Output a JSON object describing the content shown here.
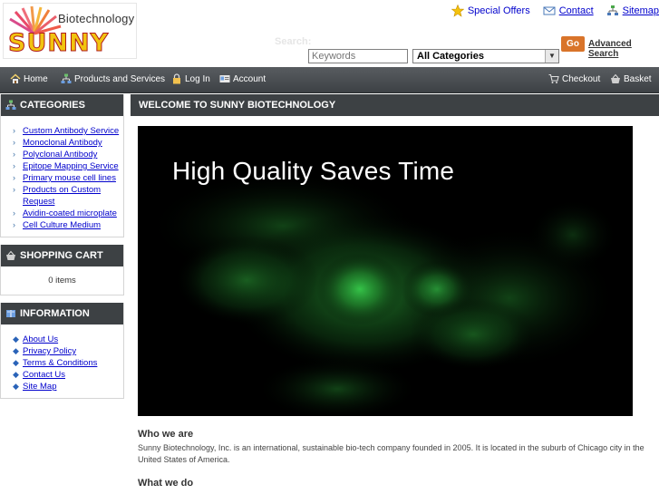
{
  "header": {
    "logo": {
      "line1": "Biotechnology",
      "line2": "SUNNY"
    },
    "toplinks": [
      {
        "label": "Special Offers",
        "icon": "star-icon"
      },
      {
        "label": "Contact",
        "icon": "envelope-icon"
      },
      {
        "label": "Sitemap",
        "icon": "sitemap-icon"
      }
    ],
    "search": {
      "label": "Search:",
      "placeholder": "Keywords",
      "category_selected": "All Categories",
      "go_label": "Go",
      "advanced_label": "Advanced Search"
    }
  },
  "nav": {
    "items": [
      {
        "label": "Home",
        "icon": "home-icon"
      },
      {
        "label": "Products and Services",
        "icon": "sitemap-icon"
      },
      {
        "label": "Log In",
        "icon": "lock-icon"
      },
      {
        "label": "Account",
        "icon": "id-card-icon"
      }
    ],
    "right": [
      {
        "label": "Checkout",
        "icon": "cart-icon"
      },
      {
        "label": "Basket",
        "icon": "basket-icon"
      }
    ]
  },
  "sidebar": {
    "categories": {
      "title": "CATEGORIES",
      "items": [
        "Custom Antibody Service",
        "Monoclonal Antibody",
        "Polyclonal Antibody",
        "Epitope Mapping Service",
        "Primary mouse cell lines",
        "Products on Custom Request",
        "Avidin-coated microplate",
        "Cell Culture Medium"
      ]
    },
    "cart": {
      "title": "SHOPPING CART",
      "summary": "0 items"
    },
    "information": {
      "title": "INFORMATION",
      "items": [
        "About Us",
        "Privacy Policy",
        "Terms & Conditions",
        "Contact Us",
        "Site Map"
      ]
    }
  },
  "main": {
    "title": "WELCOME TO SUNNY BIOTECHNOLOGY",
    "hero_text": "High Quality Saves Time",
    "sections": [
      {
        "heading": "Who we are",
        "body": "Sunny Biotechnology, Inc. is an international, sustainable bio-tech company founded in 2005. It is located in the suburb of Chicago city in the United States of America."
      },
      {
        "heading": "What we do",
        "body": ""
      }
    ]
  },
  "colors": {
    "bar": "#3d4144",
    "link": "#0000cc",
    "go_button": "#d9742a",
    "hero_glow": "#2fa33a"
  }
}
